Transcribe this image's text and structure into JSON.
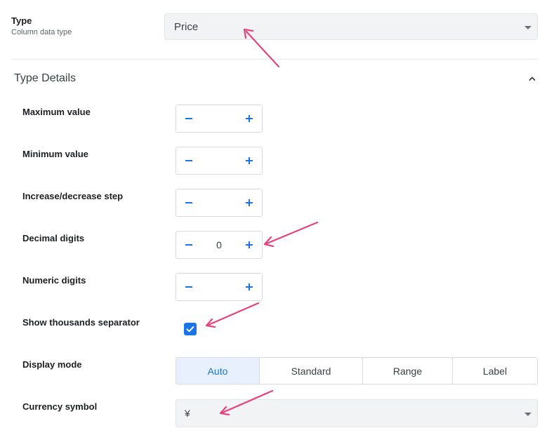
{
  "type_field": {
    "title": "Type",
    "subtitle": "Column data type",
    "selected": "Price"
  },
  "section": {
    "title": "Type Details",
    "toggle_icon": "chevron-up-icon"
  },
  "fields": {
    "max_label": "Maximum value",
    "min_label": "Minimum value",
    "step_label": "Increase/decrease step",
    "decimal_label": "Decimal digits",
    "decimal_value": "0",
    "numeric_label": "Numeric digits",
    "thousands_label": "Show thousands separator",
    "thousands_checked": true,
    "display_mode_label": "Display mode",
    "display_modes": [
      "Auto",
      "Standard",
      "Range",
      "Label"
    ],
    "display_mode_selected": "Auto",
    "currency_label": "Currency symbol",
    "currency_value": "¥"
  },
  "colors": {
    "accent": "#1a73e8",
    "annotation_arrow": "#e8437a"
  }
}
